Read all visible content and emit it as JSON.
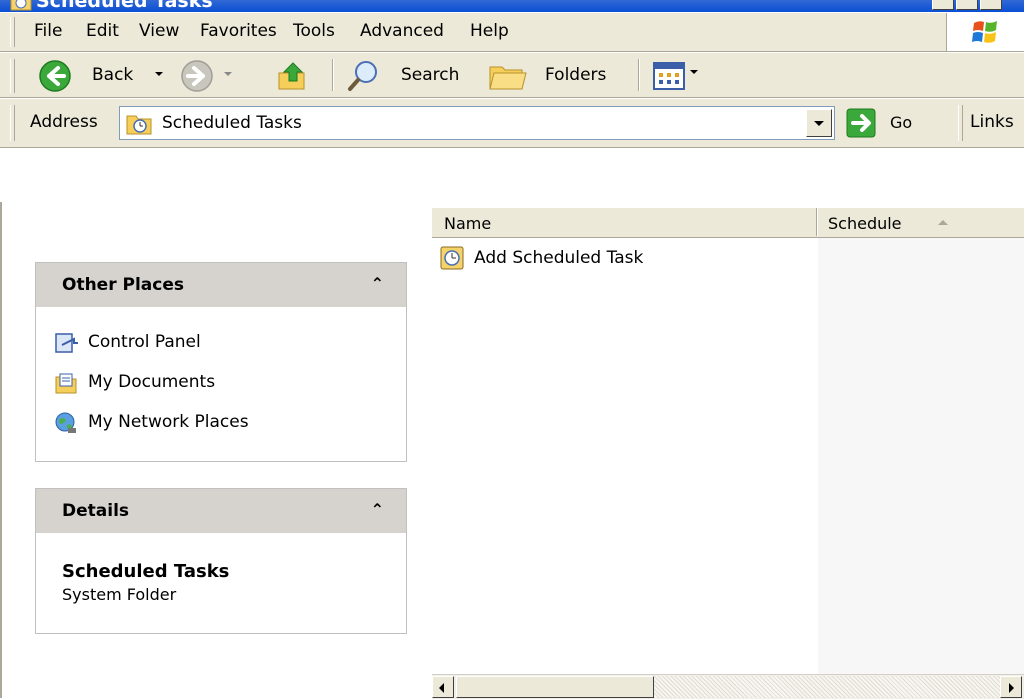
{
  "window": {
    "title": "Scheduled Tasks"
  },
  "menu": {
    "items": [
      "File",
      "Edit",
      "View",
      "Favorites",
      "Tools",
      "Advanced",
      "Help"
    ]
  },
  "toolbar": {
    "back_label": "Back",
    "search_label": "Search",
    "folders_label": "Folders"
  },
  "address": {
    "label": "Address",
    "value": "Scheduled Tasks",
    "go_label": "Go",
    "links_label": "Links"
  },
  "other_places": {
    "title": "Other Places",
    "items": [
      "Control Panel",
      "My Documents",
      "My Network Places"
    ]
  },
  "details": {
    "title": "Details",
    "name": "Scheduled Tasks",
    "type": "System Folder"
  },
  "list": {
    "columns": [
      "Name",
      "Schedule"
    ],
    "items": [
      "Add Scheduled Task"
    ]
  },
  "colors": {
    "bar_bg": "#ece9d8",
    "panel_head": "#d6d3ce",
    "title_blue": "#0a4fd3"
  }
}
